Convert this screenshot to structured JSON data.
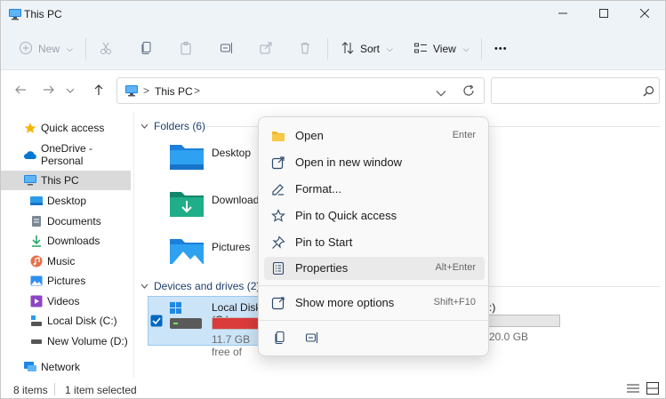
{
  "window": {
    "title": "This PC"
  },
  "toolbar": {
    "new_label": "New",
    "sort_label": "Sort",
    "view_label": "View",
    "more_label": "•••"
  },
  "address": {
    "sep1": ">",
    "location": "This PC",
    "sep2": ">",
    "search_placeholder": ""
  },
  "sidebar": {
    "items": [
      {
        "label": "Quick access",
        "icon": "star-icon"
      },
      {
        "label": "OneDrive - Personal",
        "icon": "cloud-icon"
      },
      {
        "label": "This PC",
        "icon": "computer-icon"
      },
      {
        "label": "Desktop",
        "icon": "desktop-icon"
      },
      {
        "label": "Documents",
        "icon": "documents-icon"
      },
      {
        "label": "Downloads",
        "icon": "download-icon"
      },
      {
        "label": "Music",
        "icon": "music-icon"
      },
      {
        "label": "Pictures",
        "icon": "pictures-icon"
      },
      {
        "label": "Videos",
        "icon": "videos-icon"
      },
      {
        "label": "Local Disk (C:)",
        "icon": "drive-icon"
      },
      {
        "label": "New Volume (D:)",
        "icon": "drive-icon"
      },
      {
        "label": "Network",
        "icon": "network-icon"
      }
    ]
  },
  "content": {
    "folders_header": "Folders (6)",
    "folders": [
      {
        "label": "Desktop"
      },
      {
        "label": "Downloads"
      },
      {
        "label": "Pictures"
      }
    ],
    "drives_header": "Devices and drives (2)",
    "drive_c": {
      "name": "Local Disk (C:)",
      "free_text": "11.7 GB free of",
      "used_fraction": 0.9
    },
    "drive_d": {
      "name_suffix": ":)",
      "free_text": "20.0 GB"
    }
  },
  "context_menu": {
    "items": [
      {
        "label": "Open",
        "shortcut": "Enter",
        "icon": "folder-open-icon"
      },
      {
        "label": "Open in new window",
        "shortcut": "",
        "icon": "open-new-window-icon"
      },
      {
        "label": "Format...",
        "shortcut": "",
        "icon": "format-icon"
      },
      {
        "label": "Pin to Quick access",
        "shortcut": "",
        "icon": "pin-quick-access-icon"
      },
      {
        "label": "Pin to Start",
        "shortcut": "",
        "icon": "pin-icon"
      },
      {
        "label": "Properties",
        "shortcut": "Alt+Enter",
        "icon": "properties-icon"
      },
      {
        "label": "Show more options",
        "shortcut": "Shift+F10",
        "icon": "more-options-icon"
      }
    ]
  },
  "status": {
    "items_count": "8 items",
    "selected_count": "1 item selected"
  },
  "colors": {
    "accent": "#0067c0",
    "folder_blue": "#1e88e5",
    "selection_bg": "#cce4f7",
    "drive_bar_full": "#da3b3b"
  }
}
